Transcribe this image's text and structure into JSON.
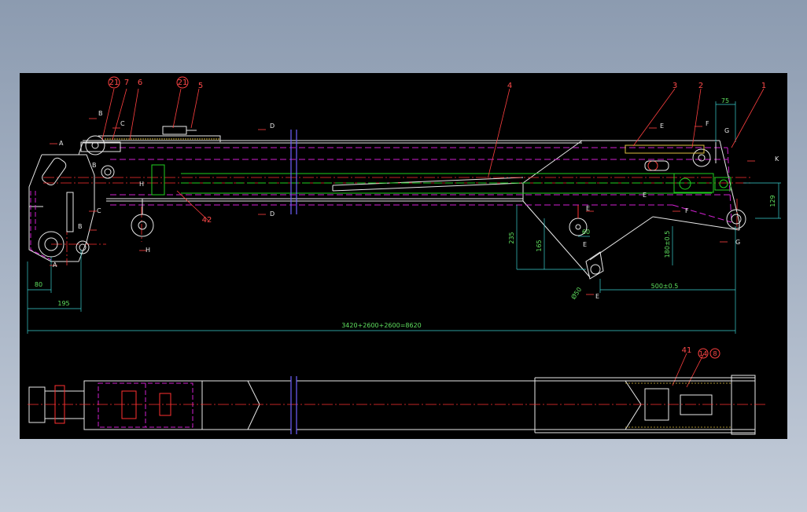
{
  "colors": {
    "background": "#000000",
    "frame": "#8c9bb0",
    "outline": "#e8e8e8",
    "hidden_line": "#d020d0",
    "center_line": "#ff3030",
    "cylinder": "#20d020",
    "dimension": "#3ad0d0",
    "dimension_text": "#5fe05f",
    "leader": "#ff4040",
    "hatch": "#e0c040"
  },
  "part_numbers": [
    {
      "id": "p21a",
      "label": "21",
      "circled": true
    },
    {
      "id": "p7",
      "label": "7",
      "circled": false
    },
    {
      "id": "p6",
      "label": "6",
      "circled": false
    },
    {
      "id": "p21b",
      "label": "21",
      "circled": true
    },
    {
      "id": "p5",
      "label": "5",
      "circled": false
    },
    {
      "id": "p4",
      "label": "4",
      "circled": false
    },
    {
      "id": "p3",
      "label": "3",
      "circled": false
    },
    {
      "id": "p2",
      "label": "2",
      "circled": false
    },
    {
      "id": "p1",
      "label": "1",
      "circled": false
    },
    {
      "id": "p42",
      "label": "42",
      "circled": false
    },
    {
      "id": "p41",
      "label": "41",
      "circled": false
    },
    {
      "id": "p14",
      "label": "14",
      "circled": true
    },
    {
      "id": "p8",
      "label": "8",
      "circled": true
    }
  ],
  "section_marks": {
    "A": "A",
    "B": "B",
    "C": "C",
    "D": "D",
    "E": "E",
    "F": "F",
    "G": "G",
    "H": "H",
    "K": "K"
  },
  "dimensions": {
    "d75": "75",
    "d129": "129",
    "d235": "235",
    "d165": "165",
    "d60": "60",
    "d180": "180±0.5",
    "d500": "500±0.5",
    "d150": "Ø50",
    "d80": "80",
    "d195": "195",
    "total": "3420+2600+2600=8620"
  }
}
